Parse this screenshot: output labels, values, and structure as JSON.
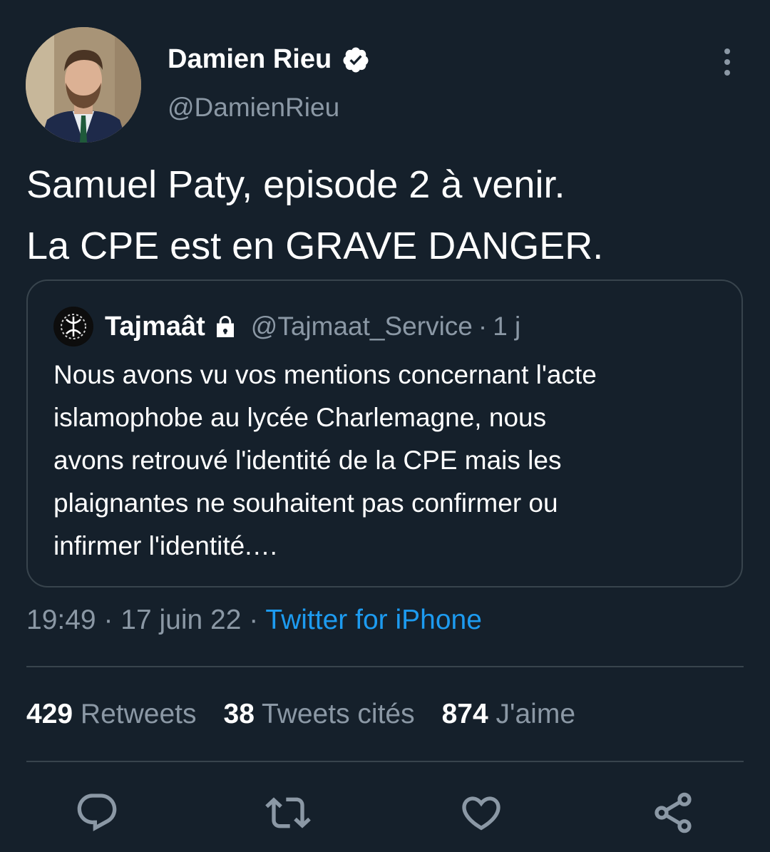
{
  "author": {
    "display_name": "Damien Rieu",
    "handle": "@DamienRieu",
    "avatar_icon": "profile-photo",
    "verified_icon": "verified-badge-icon"
  },
  "tweet": {
    "lines": [
      "Samuel Paty, episode 2 à venir.",
      "La CPE est en GRAVE DANGER."
    ]
  },
  "quoted_tweet": {
    "display_name": "Tajmaât",
    "handle": "@Tajmaat_Service",
    "separator": "·",
    "time": "1 j",
    "lines": [
      "Nous avons vu vos mentions concernant l'acte",
      "islamophobe au lycée Charlemagne, nous",
      "avons retrouvé l'identité de la CPE mais les",
      "plaignantes ne souhaitent pas confirmer ou",
      "infirmer l'identité.…"
    ]
  },
  "meta": {
    "time": "19:49",
    "separator": "·",
    "date": "17 juin 22",
    "source": "Twitter for iPhone"
  },
  "stats": {
    "retweets_count": "429",
    "retweets_label": "Retweets",
    "quotes_count": "38",
    "quotes_label": "Tweets cités",
    "likes_count": "874",
    "likes_label": "J'aime"
  },
  "colors": {
    "background": "#15202b",
    "text": "#ffffff",
    "secondary": "#8b98a5",
    "accent": "#1d9bf0",
    "border": "#38444d"
  },
  "actions": [
    "reply-icon",
    "retweet-icon",
    "like-icon",
    "share-icon"
  ]
}
